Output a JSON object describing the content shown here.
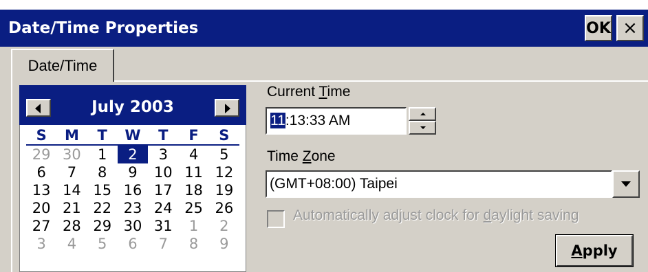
{
  "window": {
    "title": "Date/Time Properties",
    "ok_label": "OK",
    "close_label": "×"
  },
  "tabs": [
    {
      "label": "Date/Time",
      "selected": true
    }
  ],
  "calendar": {
    "month_label": "July 2003",
    "weekdays": [
      "S",
      "M",
      "T",
      "W",
      "T",
      "F",
      "S"
    ],
    "days": [
      {
        "d": "29",
        "other": true
      },
      {
        "d": "30",
        "other": true
      },
      {
        "d": "1"
      },
      {
        "d": "2",
        "selected": true
      },
      {
        "d": "3"
      },
      {
        "d": "4"
      },
      {
        "d": "5"
      },
      {
        "d": "6"
      },
      {
        "d": "7"
      },
      {
        "d": "8"
      },
      {
        "d": "9"
      },
      {
        "d": "10"
      },
      {
        "d": "11"
      },
      {
        "d": "12"
      },
      {
        "d": "13"
      },
      {
        "d": "14"
      },
      {
        "d": "15"
      },
      {
        "d": "16"
      },
      {
        "d": "17"
      },
      {
        "d": "18"
      },
      {
        "d": "19"
      },
      {
        "d": "20"
      },
      {
        "d": "21"
      },
      {
        "d": "22"
      },
      {
        "d": "23"
      },
      {
        "d": "24"
      },
      {
        "d": "25"
      },
      {
        "d": "26"
      },
      {
        "d": "27"
      },
      {
        "d": "28"
      },
      {
        "d": "29"
      },
      {
        "d": "30"
      },
      {
        "d": "31"
      },
      {
        "d": "1",
        "other": true
      },
      {
        "d": "2",
        "other": true
      },
      {
        "d": "3",
        "other": true
      },
      {
        "d": "4",
        "other": true
      },
      {
        "d": "5",
        "other": true
      },
      {
        "d": "6",
        "other": true
      },
      {
        "d": "7",
        "other": true
      },
      {
        "d": "8",
        "other": true
      },
      {
        "d": "9",
        "other": true
      }
    ]
  },
  "current_time": {
    "label_pre": "Current ",
    "label_accel": "T",
    "label_post": "ime",
    "hour": "11",
    "rest": ":13:33 AM"
  },
  "time_zone": {
    "label_pre": "Time ",
    "label_accel": "Z",
    "label_post": "one",
    "value": "(GMT+08:00) Taipei"
  },
  "dst": {
    "label_pre": "Automatically adjust clock for ",
    "label_accel": "d",
    "label_post": "aylight saving",
    "checked": false,
    "enabled": false
  },
  "apply": {
    "accel": "A",
    "rest": "pply"
  },
  "colors": {
    "title_bar": "#0a1e82",
    "face": "#d4d0c8",
    "selection": "#0a1e82"
  }
}
